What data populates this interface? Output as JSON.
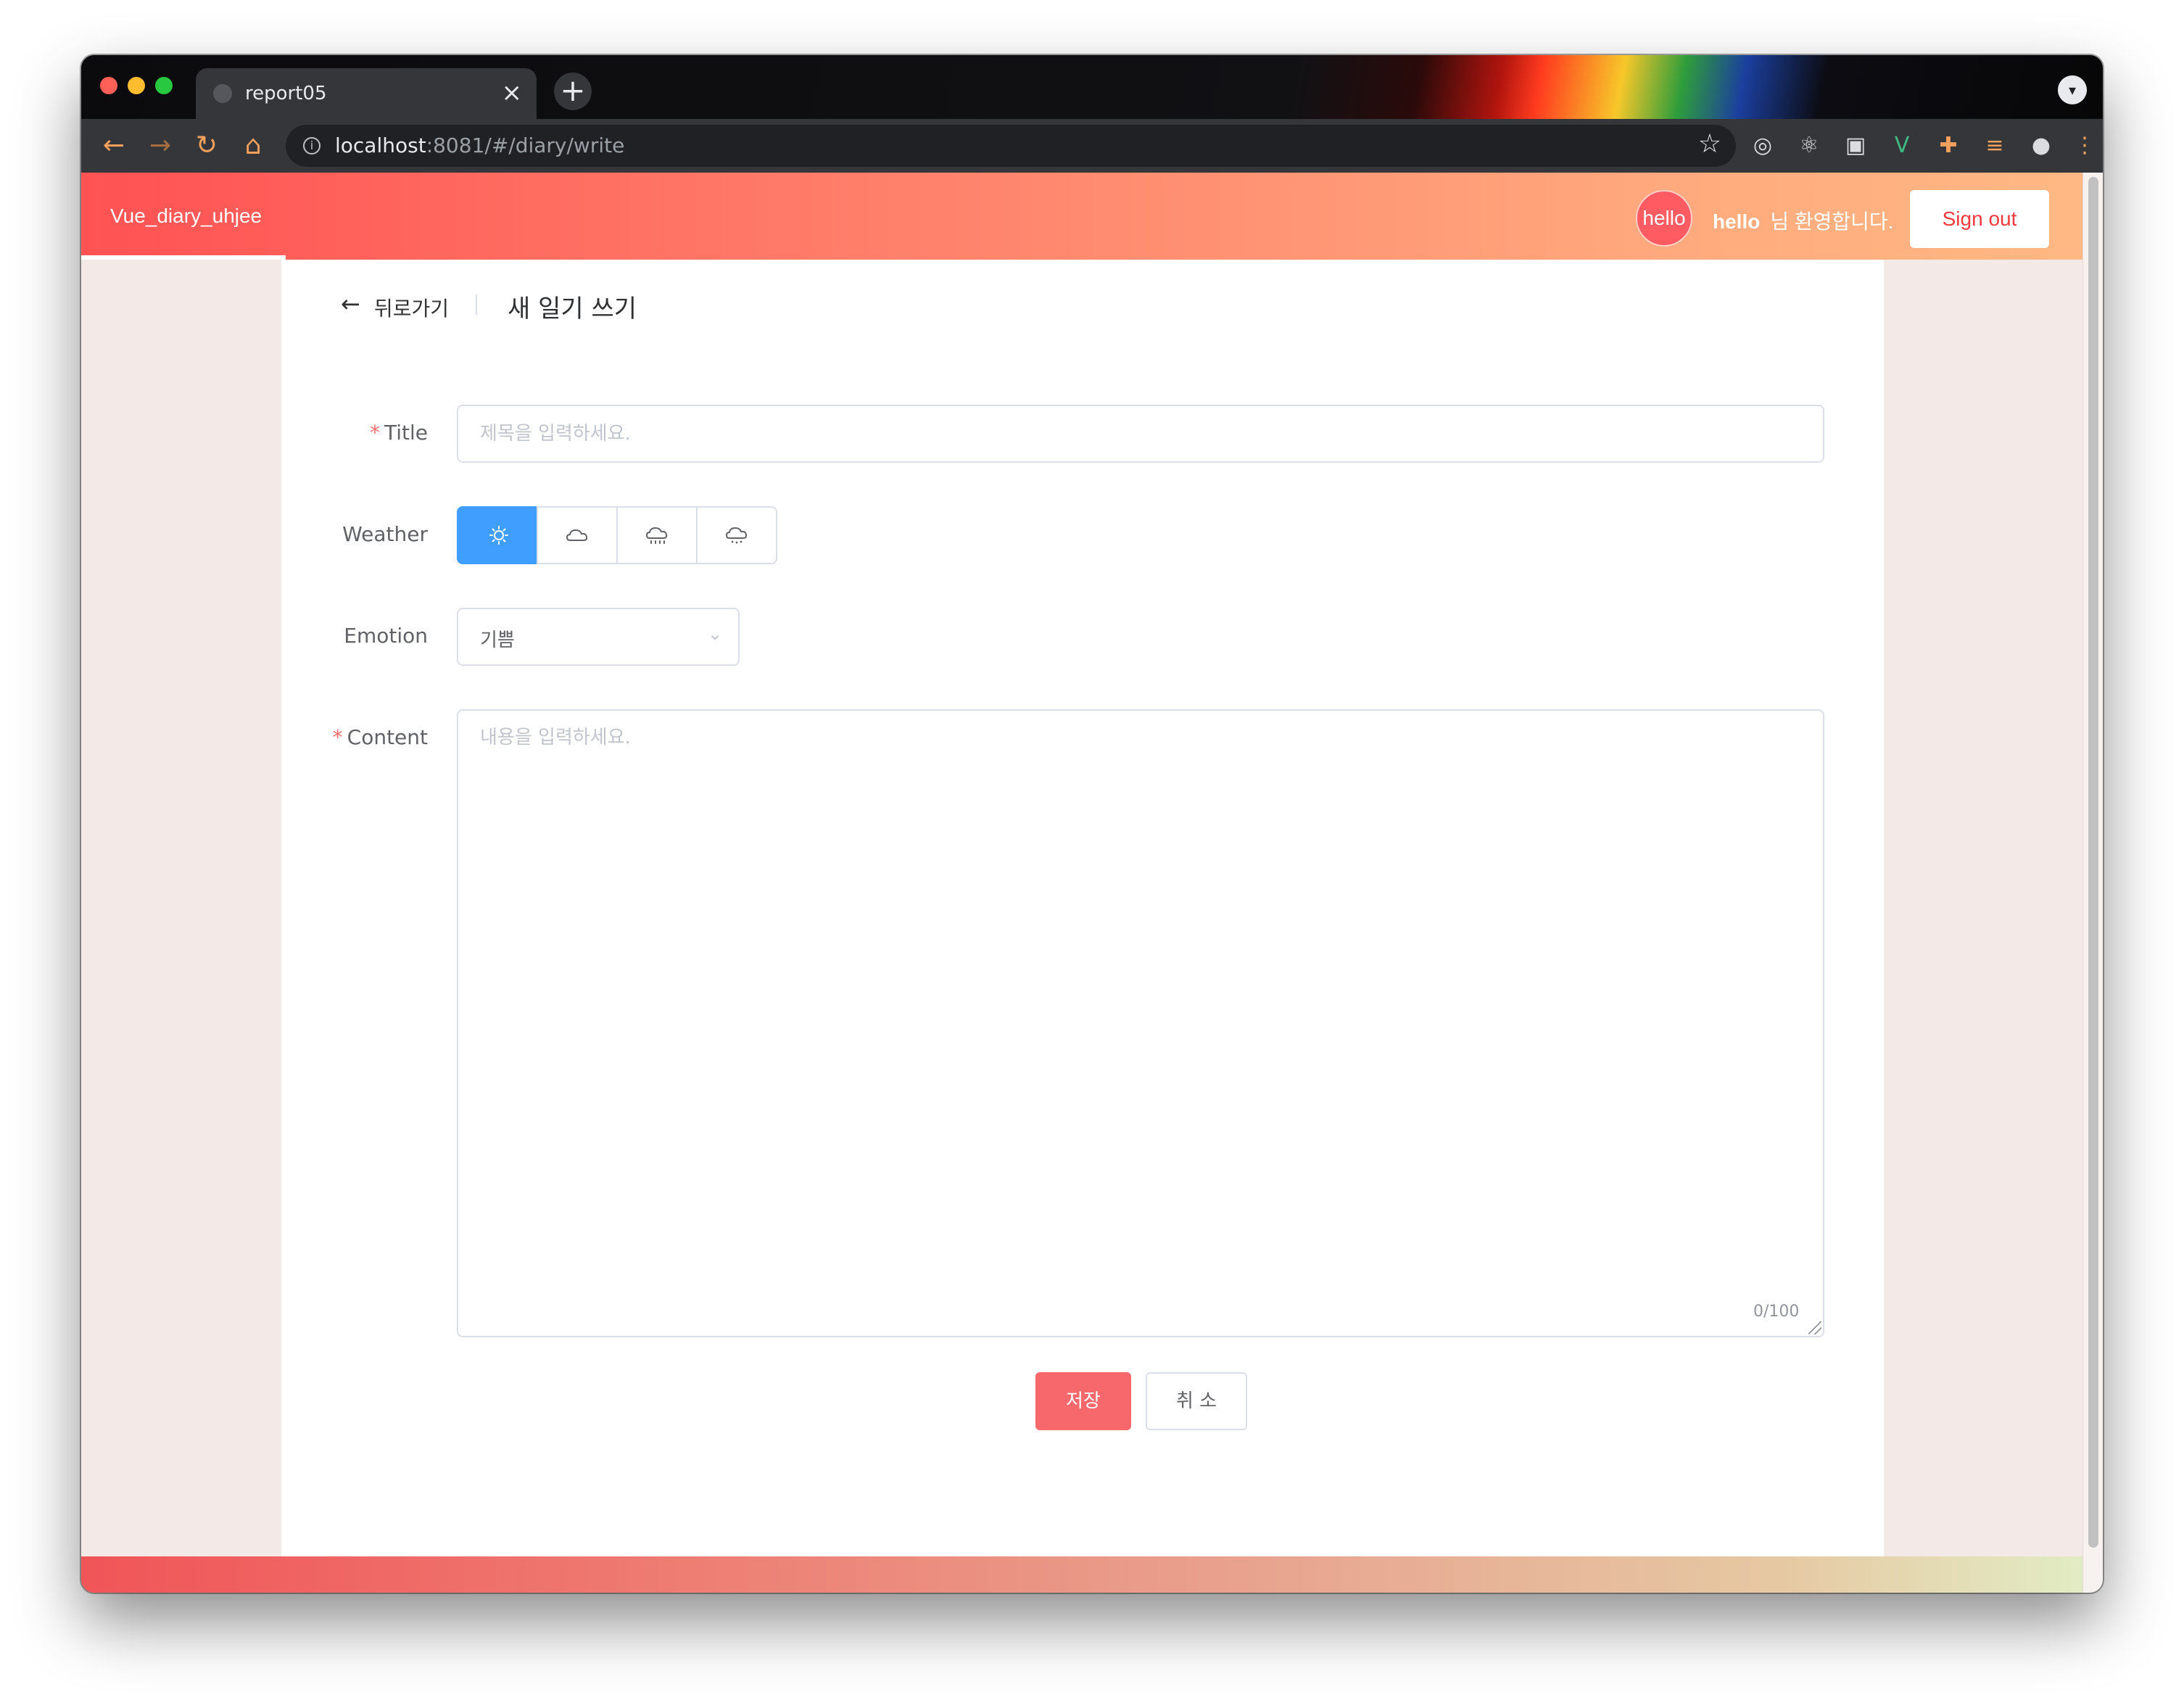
{
  "browser": {
    "tab_title": "report05",
    "tab_close": "×",
    "new_tab": "+",
    "url_host": "localhost",
    "url_rest": ":8081/#/diary/write"
  },
  "header": {
    "brand": "Vue_diary_uhjee",
    "avatar_text": "hello",
    "username": "hello",
    "welcome_suffix": "님 환영합니다.",
    "signout_label": "Sign out"
  },
  "page_head": {
    "back_label": "뒤로가기",
    "title": "새 일기 쓰기"
  },
  "form": {
    "title_label": "Title",
    "title_placeholder": "제목을 입력하세요.",
    "weather_label": "Weather",
    "weather_options": [
      "sunny",
      "cloudy",
      "rainy",
      "snowy"
    ],
    "weather_selected": "sunny",
    "emotion_label": "Emotion",
    "emotion_value": "기쁨",
    "content_label": "Content",
    "content_placeholder": "내용을 입력하세요.",
    "char_count": "0/100",
    "required_mark": "*"
  },
  "actions": {
    "save_label": "저장",
    "cancel_label": "취 소"
  },
  "colors": {
    "header_start": "#ff5253",
    "header_end": "#ffb883",
    "primary_blue": "#409eff",
    "save_button": "#f7686c",
    "signout_text": "#f5393f"
  },
  "icons": {
    "back": "arrow-left-icon",
    "weather": [
      "sun-icon",
      "cloud-icon",
      "cloud-rain-icon",
      "cloud-snow-icon"
    ],
    "select": "chevron-down-icon"
  }
}
